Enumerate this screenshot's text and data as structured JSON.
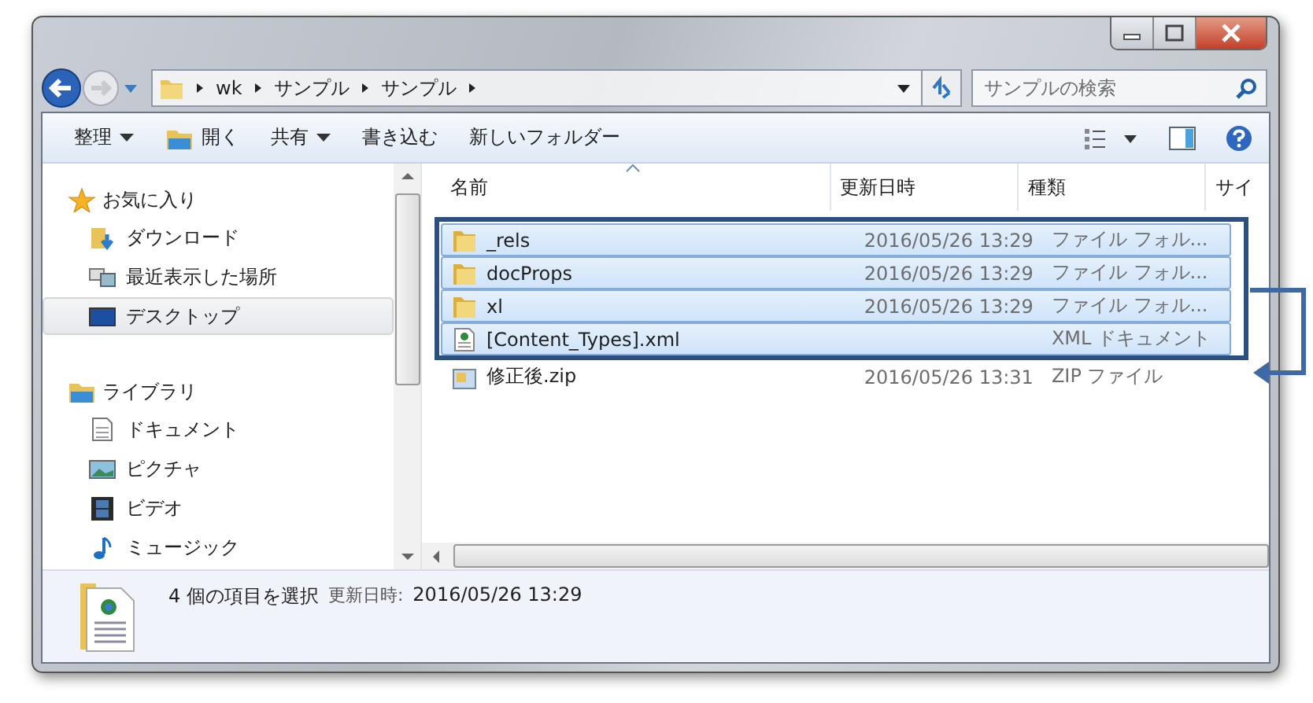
{
  "address_bar": {
    "path": [
      "wk",
      "サンプル",
      "サンプル"
    ]
  },
  "search": {
    "placeholder": "サンプルの検索"
  },
  "toolbar": {
    "items": [
      {
        "label": "整理",
        "kind": "menu"
      },
      {
        "label": "開く",
        "kind": "open"
      },
      {
        "label": "共有",
        "kind": "menu"
      },
      {
        "label": "書き込む",
        "kind": "plain"
      },
      {
        "label": "新しいフォルダー",
        "kind": "plain"
      }
    ]
  },
  "sidebar": {
    "groups": [
      {
        "label": "お気に入り",
        "kind": "favorites",
        "children": [
          {
            "label": "ダウンロード",
            "kind": "download",
            "selected": false
          },
          {
            "label": "最近表示した場所",
            "kind": "recent",
            "selected": false
          },
          {
            "label": "デスクトップ",
            "kind": "desktop",
            "selected": true
          }
        ]
      },
      {
        "label": "ライブラリ",
        "kind": "library",
        "children": [
          {
            "label": "ドキュメント",
            "kind": "document",
            "selected": false
          },
          {
            "label": "ピクチャ",
            "kind": "picture",
            "selected": false
          },
          {
            "label": "ビデオ",
            "kind": "video",
            "selected": false
          },
          {
            "label": "ミュージック",
            "kind": "music",
            "selected": false
          }
        ]
      }
    ]
  },
  "table": {
    "columns": [
      {
        "label": "名前",
        "sorted": true
      },
      {
        "label": "更新日時",
        "sorted": false
      },
      {
        "label": "種類",
        "sorted": false
      },
      {
        "label": "サイ",
        "sorted": false
      }
    ],
    "rows": [
      {
        "name": "_rels",
        "modified": "2016/05/26 13:29",
        "type": "ファイル フォル...",
        "kind": "folder",
        "selected": true
      },
      {
        "name": "docProps",
        "modified": "2016/05/26 13:29",
        "type": "ファイル フォル...",
        "kind": "folder",
        "selected": true
      },
      {
        "name": "xl",
        "modified": "2016/05/26 13:29",
        "type": "ファイル フォル...",
        "kind": "folder",
        "selected": true
      },
      {
        "name": "[Content_Types].xml",
        "type": "XML ドキュメント",
        "kind": "xml",
        "selected": true
      },
      {
        "name": "修正後.zip",
        "modified": "2016/05/26 13:31",
        "type": "ZIP ファイル",
        "kind": "zip",
        "selected": false
      }
    ]
  },
  "status_bar": {
    "selection": "4 個の項目を選択",
    "detail_label": "更新日時:",
    "detail_value": "2016/05/26 13:29"
  }
}
